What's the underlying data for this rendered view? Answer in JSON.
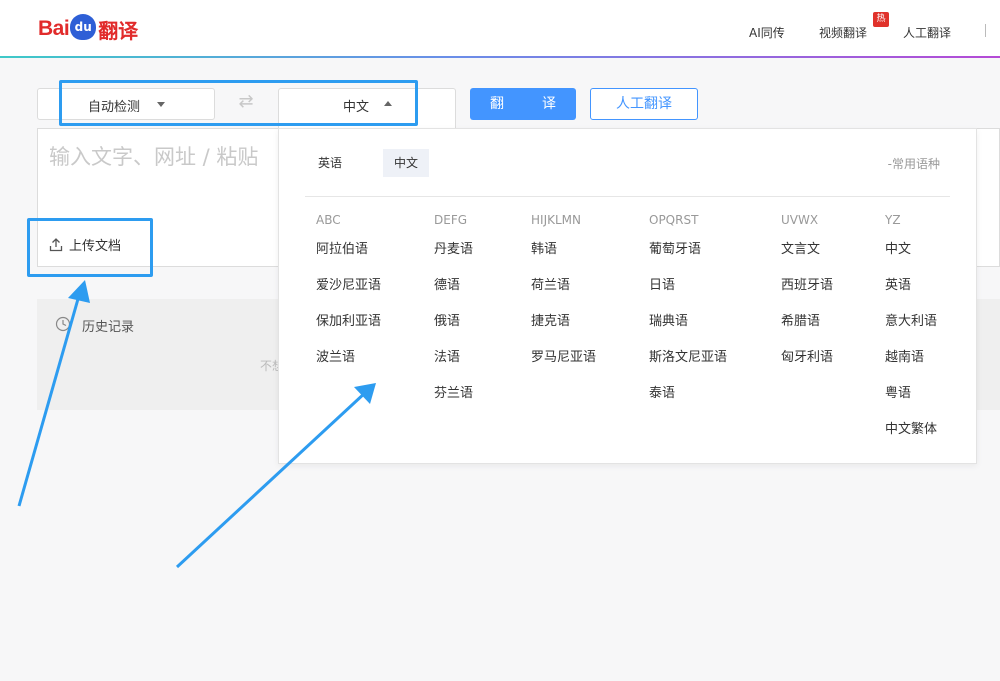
{
  "header": {
    "logo_bai": "Bai",
    "logo_du": "du",
    "logo_fanyi": "翻译",
    "nav": [
      {
        "label": "AI同传"
      },
      {
        "label": "视频翻译"
      },
      {
        "label": "人工翻译"
      }
    ],
    "hot_badge": "热"
  },
  "toolbar": {
    "source_lang": "自动检测",
    "target_lang": "中文",
    "translate_button": "翻　译",
    "human_translate_button": "人工翻译"
  },
  "input": {
    "placeholder": "输入文字、网址 / 粘贴",
    "upload_label": "上传文档"
  },
  "history": {
    "title": "历史记录",
    "empty_text": "不想"
  },
  "dropdown": {
    "recent": [
      {
        "label": "英语",
        "active": false
      },
      {
        "label": "中文",
        "active": true
      }
    ],
    "recent_label": "-常用语种",
    "columns": [
      {
        "head": "ABC",
        "items": [
          "阿拉伯语",
          "爱沙尼亚语",
          "保加利亚语",
          "波兰语"
        ]
      },
      {
        "head": "DEFG",
        "items": [
          "丹麦语",
          "德语",
          "俄语",
          "法语",
          "芬兰语"
        ]
      },
      {
        "head": "HIJKLMN",
        "items": [
          "韩语",
          "荷兰语",
          "捷克语",
          "罗马尼亚语"
        ]
      },
      {
        "head": "OPQRST",
        "items": [
          "葡萄牙语",
          "日语",
          "瑞典语",
          "斯洛文尼亚语",
          "泰语"
        ]
      },
      {
        "head": "UVWX",
        "items": [
          "文言文",
          "西班牙语",
          "希腊语",
          "匈牙利语"
        ]
      },
      {
        "head": "YZ",
        "items": [
          "中文",
          "英语",
          "意大利语",
          "越南语",
          "粤语",
          "中文繁体"
        ]
      }
    ]
  },
  "colors": {
    "accent": "#4395ff",
    "brand_red": "#e12b2b",
    "annotation_blue": "#2d9cf0"
  },
  "icons": [
    "swap-icon",
    "upload-icon",
    "clock-icon",
    "chevron-down-icon",
    "chevron-up-icon"
  ]
}
